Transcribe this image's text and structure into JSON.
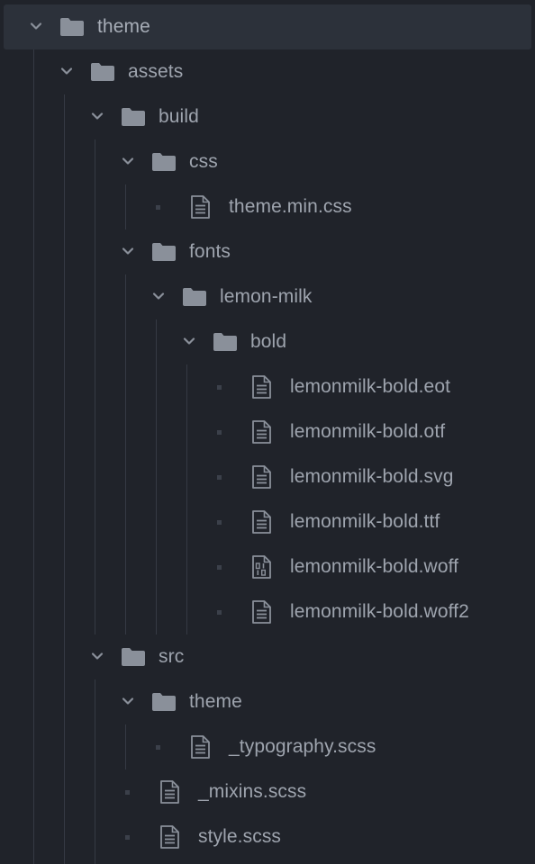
{
  "tree": {
    "rows": [
      {
        "type": "folder",
        "depth": 0,
        "label": "theme",
        "expanded": true,
        "selected": true
      },
      {
        "type": "folder",
        "depth": 1,
        "label": "assets",
        "expanded": true
      },
      {
        "type": "folder",
        "depth": 2,
        "label": "build",
        "expanded": true
      },
      {
        "type": "folder",
        "depth": 3,
        "label": "css",
        "expanded": true
      },
      {
        "type": "file",
        "depth": 4,
        "label": "theme.min.css",
        "icon": "text-file-icon"
      },
      {
        "type": "folder",
        "depth": 3,
        "label": "fonts",
        "expanded": true
      },
      {
        "type": "folder",
        "depth": 4,
        "label": "lemon-milk",
        "expanded": true
      },
      {
        "type": "folder",
        "depth": 5,
        "label": "bold",
        "expanded": true
      },
      {
        "type": "file",
        "depth": 6,
        "label": "lemonmilk-bold.eot",
        "icon": "text-file-icon"
      },
      {
        "type": "file",
        "depth": 6,
        "label": "lemonmilk-bold.otf",
        "icon": "text-file-icon"
      },
      {
        "type": "file",
        "depth": 6,
        "label": "lemonmilk-bold.svg",
        "icon": "text-file-icon"
      },
      {
        "type": "file",
        "depth": 6,
        "label": "lemonmilk-bold.ttf",
        "icon": "text-file-icon"
      },
      {
        "type": "file",
        "depth": 6,
        "label": "lemonmilk-bold.woff",
        "icon": "binary-file-icon"
      },
      {
        "type": "file",
        "depth": 6,
        "label": "lemonmilk-bold.woff2",
        "icon": "text-file-icon"
      },
      {
        "type": "folder",
        "depth": 2,
        "label": "src",
        "expanded": true
      },
      {
        "type": "folder",
        "depth": 3,
        "label": "theme",
        "expanded": true
      },
      {
        "type": "file",
        "depth": 4,
        "label": "_typography.scss",
        "icon": "text-file-icon"
      },
      {
        "type": "file",
        "depth": 3,
        "label": "_mixins.scss",
        "icon": "text-file-icon"
      },
      {
        "type": "file",
        "depth": 3,
        "label": "style.scss",
        "icon": "text-file-icon"
      }
    ]
  },
  "colors": {
    "background": "#20232a",
    "selected_row": "#2c313a",
    "text": "#9ea4ae",
    "icon": "#8a909a",
    "guide": "#353a44"
  }
}
